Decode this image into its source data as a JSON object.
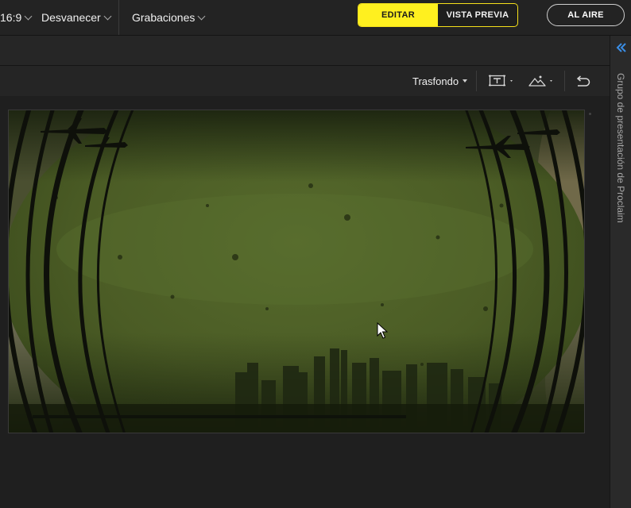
{
  "header": {
    "aspect_ratio": "16:9",
    "transition": "Desvanecer",
    "recordings": "Grabaciones",
    "mode_edit": "EDITAR",
    "mode_preview": "VISTA PREVIA",
    "live": "AL AIRE",
    "active_mode": "EDITAR"
  },
  "toolbar": {
    "background_menu": "Trasfondo",
    "text_tool_icon": "text-box-icon",
    "image_tool_icon": "image-mountain-icon",
    "undo_icon": "undo-icon"
  },
  "right_panel": {
    "collapse_icon": "double-chevron-left-icon",
    "title": "Grupo de presentación de Proclaim"
  },
  "slide": {
    "description_icon": "grunge-city-background",
    "colors": {
      "green_main": "#4c5c26",
      "green_dark": "#2a3414",
      "ink": "#0e100a"
    }
  },
  "colors": {
    "accent_yellow": "#fff01f",
    "accent_blue": "#3a8ee6",
    "bg": "#1f1f1f",
    "bar": "#232323"
  }
}
